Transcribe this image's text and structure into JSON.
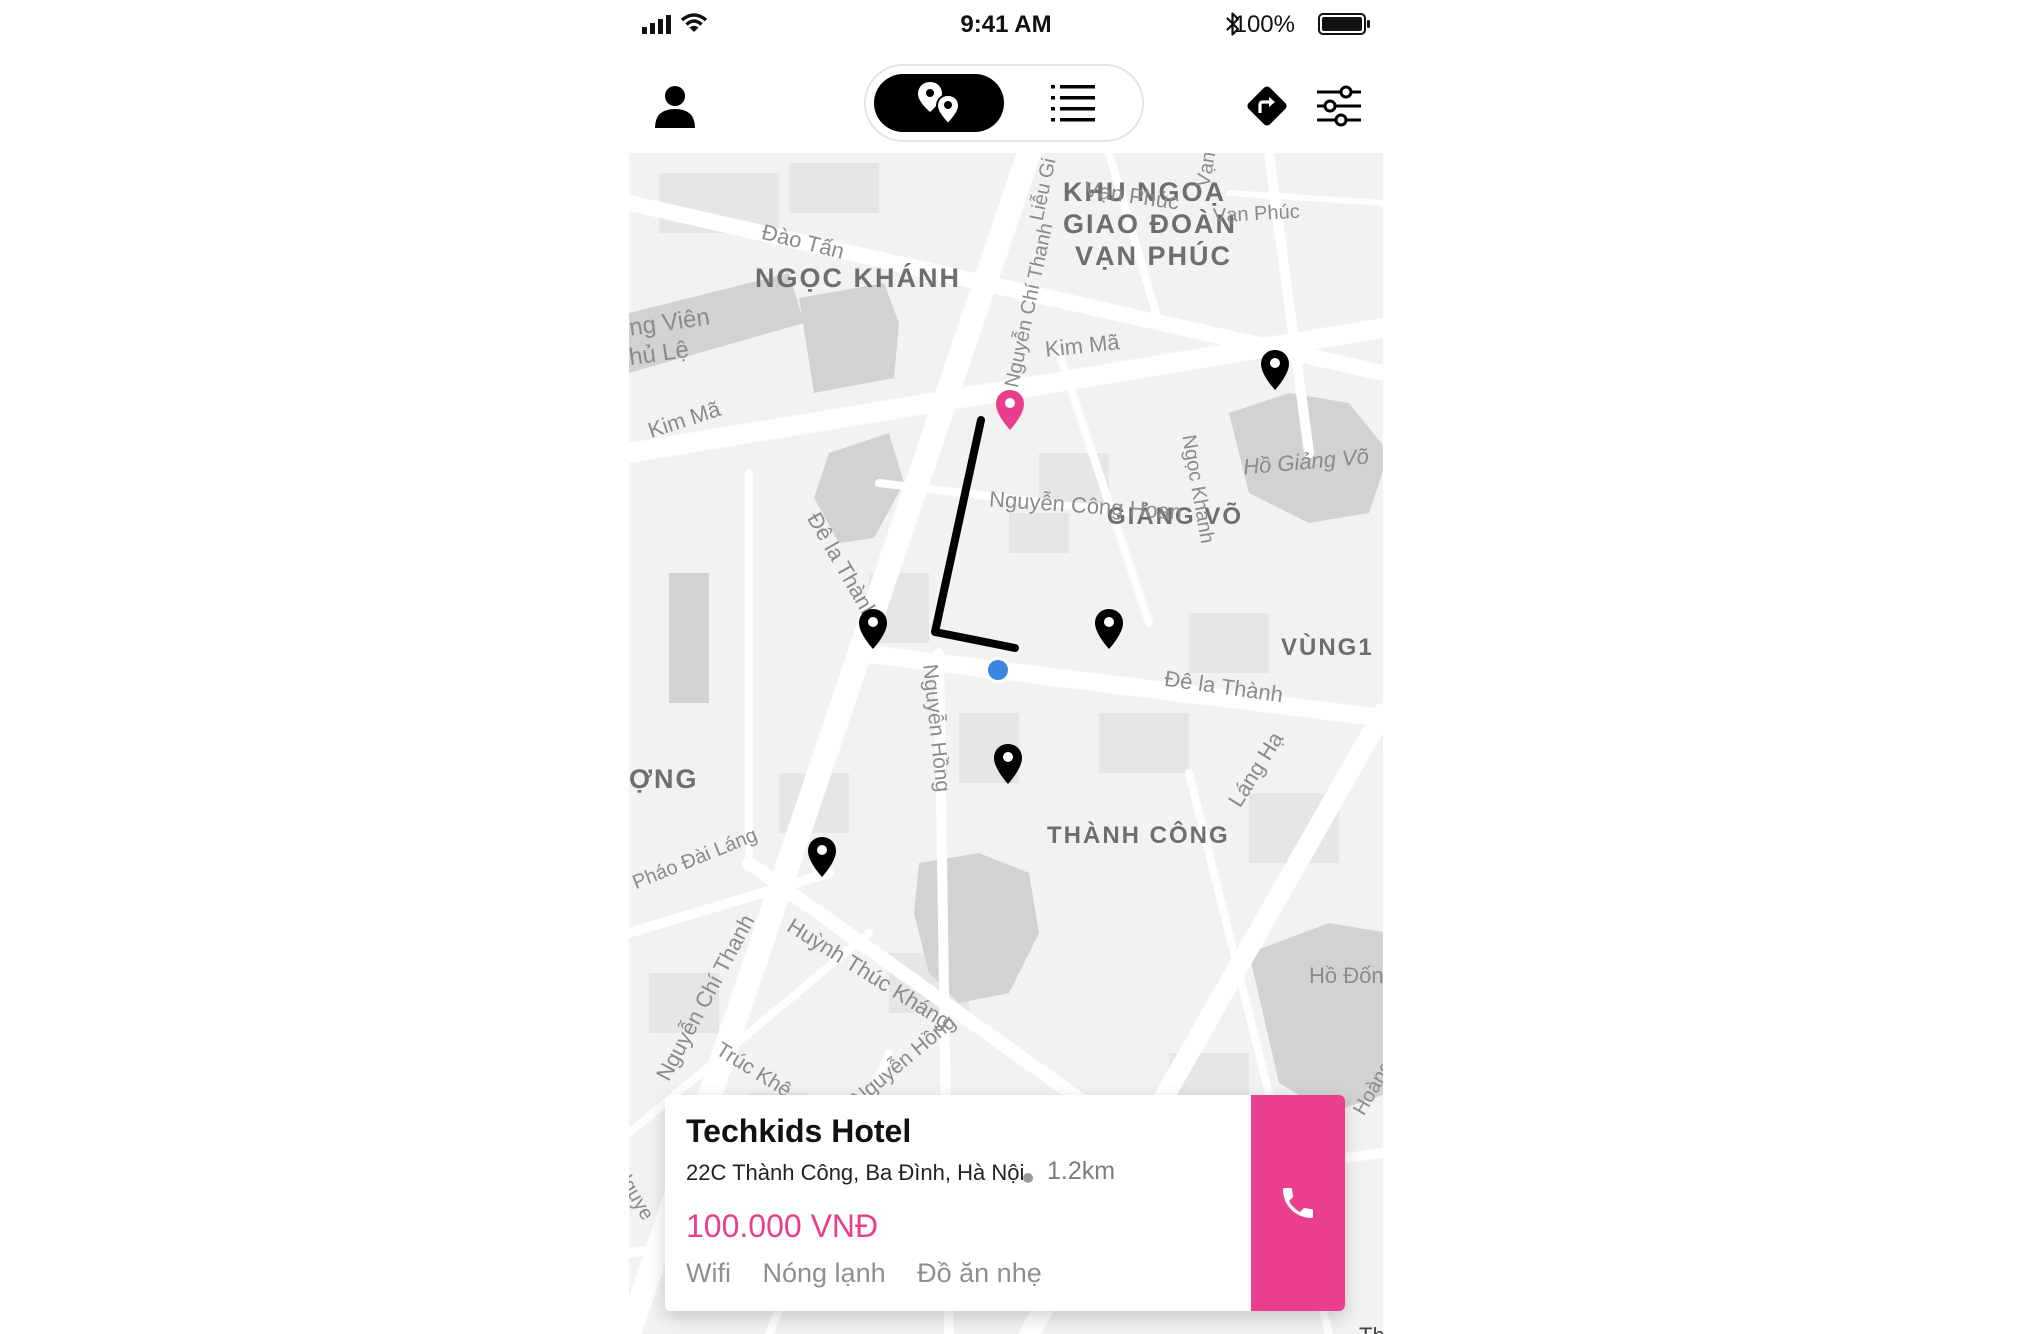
{
  "status_bar": {
    "time": "9:41 AM",
    "battery_text": "100%"
  },
  "nav": {
    "profile_icon": "person-icon",
    "view_toggle": {
      "map_icon": "map-pins-icon",
      "list_icon": "list-icon",
      "selected": "map"
    },
    "directions_icon": "directions-icon",
    "filter_icon": "sliders-icon"
  },
  "map": {
    "areas": {
      "ngoc_khanh": "NGỌC KHÁNH",
      "khu_1": "KHU NGOẠ",
      "khu_2": "GIAO ĐOÀN",
      "khu_3": "VẠN PHÚC",
      "giang_vo": "GIẢNG VÕ",
      "vung1": "VÙNG1",
      "thanh_cong": "THÀNH CÔNG",
      "ong": "ỢNG"
    },
    "streets": {
      "van_phuc_1": "Vạn Phúc",
      "van_phuc_2": "Vạn Phúc",
      "van": "Vạn",
      "lieu_gi": "Liễu Gi",
      "dao_tan": "Đào Tấn",
      "vien_1": "ng Viên",
      "vien_2": "hủ Lệ",
      "kim_ma_1": "Kim Mã",
      "kim_ma_2": "Kim Mã",
      "ngoc_khanh_st": "Ngọc Khánh",
      "ho_giang_vo": "Hồ Giảng Võ",
      "nguyen_chi_thanh_top": "Nguyễn Chí Thanh",
      "nguyen_cong_hoan": "Nguyễn Công Hoan",
      "de_la_thanh_1": "Đê la Thành",
      "de_la_thanh_2": "Đê la Thành",
      "nguyen_hong_1": "Nguyễn Hồng",
      "nguyen_hong_2": "Nguyễn Hồng",
      "lang_ha": "Láng Hạ",
      "phao_dai_lang": "Pháo Đài Láng",
      "huynh_thuc_khang": "Huỳnh Thúc Kháng",
      "nguyen_chi_thanh_bottom": "Nguyễn Chí Thanh",
      "truc_khe": "Trúc Khê",
      "ho_dong": "Hồ Đống",
      "hoang": "Hoàng",
      "nguye": "Nguye",
      "th": "Th"
    },
    "selected_pin_color": "#e83e8c",
    "pin_color": "#000000",
    "user_location_color": "#3a86e0"
  },
  "hotel_card": {
    "name": "Techkids Hotel",
    "address": "22C Thành Công, Ba Đình, Hà Nội",
    "distance": "1.2km",
    "price": "100.000 VNĐ",
    "amenities": [
      "Wifi",
      "Nóng lạnh",
      "Đồ ăn nhẹ"
    ],
    "call_icon": "phone-icon",
    "accent_color": "#ea3f8f"
  }
}
